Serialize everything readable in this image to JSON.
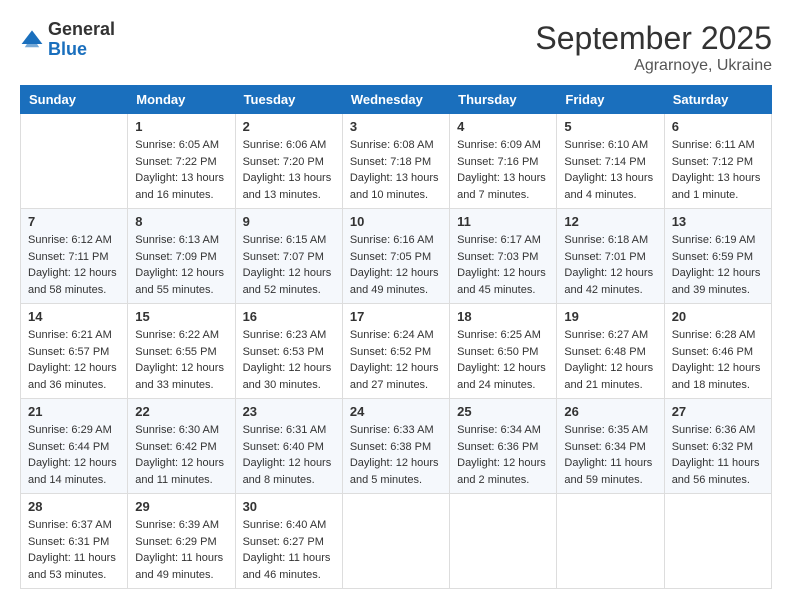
{
  "logo": {
    "general": "General",
    "blue": "Blue"
  },
  "header": {
    "month": "September 2025",
    "location": "Agrarnoye, Ukraine"
  },
  "weekdays": [
    "Sunday",
    "Monday",
    "Tuesday",
    "Wednesday",
    "Thursday",
    "Friday",
    "Saturday"
  ],
  "weeks": [
    [
      {
        "day": "",
        "sunrise": "",
        "sunset": "",
        "daylight": ""
      },
      {
        "day": "1",
        "sunrise": "Sunrise: 6:05 AM",
        "sunset": "Sunset: 7:22 PM",
        "daylight": "Daylight: 13 hours and 16 minutes."
      },
      {
        "day": "2",
        "sunrise": "Sunrise: 6:06 AM",
        "sunset": "Sunset: 7:20 PM",
        "daylight": "Daylight: 13 hours and 13 minutes."
      },
      {
        "day": "3",
        "sunrise": "Sunrise: 6:08 AM",
        "sunset": "Sunset: 7:18 PM",
        "daylight": "Daylight: 13 hours and 10 minutes."
      },
      {
        "day": "4",
        "sunrise": "Sunrise: 6:09 AM",
        "sunset": "Sunset: 7:16 PM",
        "daylight": "Daylight: 13 hours and 7 minutes."
      },
      {
        "day": "5",
        "sunrise": "Sunrise: 6:10 AM",
        "sunset": "Sunset: 7:14 PM",
        "daylight": "Daylight: 13 hours and 4 minutes."
      },
      {
        "day": "6",
        "sunrise": "Sunrise: 6:11 AM",
        "sunset": "Sunset: 7:12 PM",
        "daylight": "Daylight: 13 hours and 1 minute."
      }
    ],
    [
      {
        "day": "7",
        "sunrise": "Sunrise: 6:12 AM",
        "sunset": "Sunset: 7:11 PM",
        "daylight": "Daylight: 12 hours and 58 minutes."
      },
      {
        "day": "8",
        "sunrise": "Sunrise: 6:13 AM",
        "sunset": "Sunset: 7:09 PM",
        "daylight": "Daylight: 12 hours and 55 minutes."
      },
      {
        "day": "9",
        "sunrise": "Sunrise: 6:15 AM",
        "sunset": "Sunset: 7:07 PM",
        "daylight": "Daylight: 12 hours and 52 minutes."
      },
      {
        "day": "10",
        "sunrise": "Sunrise: 6:16 AM",
        "sunset": "Sunset: 7:05 PM",
        "daylight": "Daylight: 12 hours and 49 minutes."
      },
      {
        "day": "11",
        "sunrise": "Sunrise: 6:17 AM",
        "sunset": "Sunset: 7:03 PM",
        "daylight": "Daylight: 12 hours and 45 minutes."
      },
      {
        "day": "12",
        "sunrise": "Sunrise: 6:18 AM",
        "sunset": "Sunset: 7:01 PM",
        "daylight": "Daylight: 12 hours and 42 minutes."
      },
      {
        "day": "13",
        "sunrise": "Sunrise: 6:19 AM",
        "sunset": "Sunset: 6:59 PM",
        "daylight": "Daylight: 12 hours and 39 minutes."
      }
    ],
    [
      {
        "day": "14",
        "sunrise": "Sunrise: 6:21 AM",
        "sunset": "Sunset: 6:57 PM",
        "daylight": "Daylight: 12 hours and 36 minutes."
      },
      {
        "day": "15",
        "sunrise": "Sunrise: 6:22 AM",
        "sunset": "Sunset: 6:55 PM",
        "daylight": "Daylight: 12 hours and 33 minutes."
      },
      {
        "day": "16",
        "sunrise": "Sunrise: 6:23 AM",
        "sunset": "Sunset: 6:53 PM",
        "daylight": "Daylight: 12 hours and 30 minutes."
      },
      {
        "day": "17",
        "sunrise": "Sunrise: 6:24 AM",
        "sunset": "Sunset: 6:52 PM",
        "daylight": "Daylight: 12 hours and 27 minutes."
      },
      {
        "day": "18",
        "sunrise": "Sunrise: 6:25 AM",
        "sunset": "Sunset: 6:50 PM",
        "daylight": "Daylight: 12 hours and 24 minutes."
      },
      {
        "day": "19",
        "sunrise": "Sunrise: 6:27 AM",
        "sunset": "Sunset: 6:48 PM",
        "daylight": "Daylight: 12 hours and 21 minutes."
      },
      {
        "day": "20",
        "sunrise": "Sunrise: 6:28 AM",
        "sunset": "Sunset: 6:46 PM",
        "daylight": "Daylight: 12 hours and 18 minutes."
      }
    ],
    [
      {
        "day": "21",
        "sunrise": "Sunrise: 6:29 AM",
        "sunset": "Sunset: 6:44 PM",
        "daylight": "Daylight: 12 hours and 14 minutes."
      },
      {
        "day": "22",
        "sunrise": "Sunrise: 6:30 AM",
        "sunset": "Sunset: 6:42 PM",
        "daylight": "Daylight: 12 hours and 11 minutes."
      },
      {
        "day": "23",
        "sunrise": "Sunrise: 6:31 AM",
        "sunset": "Sunset: 6:40 PM",
        "daylight": "Daylight: 12 hours and 8 minutes."
      },
      {
        "day": "24",
        "sunrise": "Sunrise: 6:33 AM",
        "sunset": "Sunset: 6:38 PM",
        "daylight": "Daylight: 12 hours and 5 minutes."
      },
      {
        "day": "25",
        "sunrise": "Sunrise: 6:34 AM",
        "sunset": "Sunset: 6:36 PM",
        "daylight": "Daylight: 12 hours and 2 minutes."
      },
      {
        "day": "26",
        "sunrise": "Sunrise: 6:35 AM",
        "sunset": "Sunset: 6:34 PM",
        "daylight": "Daylight: 11 hours and 59 minutes."
      },
      {
        "day": "27",
        "sunrise": "Sunrise: 6:36 AM",
        "sunset": "Sunset: 6:32 PM",
        "daylight": "Daylight: 11 hours and 56 minutes."
      }
    ],
    [
      {
        "day": "28",
        "sunrise": "Sunrise: 6:37 AM",
        "sunset": "Sunset: 6:31 PM",
        "daylight": "Daylight: 11 hours and 53 minutes."
      },
      {
        "day": "29",
        "sunrise": "Sunrise: 6:39 AM",
        "sunset": "Sunset: 6:29 PM",
        "daylight": "Daylight: 11 hours and 49 minutes."
      },
      {
        "day": "30",
        "sunrise": "Sunrise: 6:40 AM",
        "sunset": "Sunset: 6:27 PM",
        "daylight": "Daylight: 11 hours and 46 minutes."
      },
      {
        "day": "",
        "sunrise": "",
        "sunset": "",
        "daylight": ""
      },
      {
        "day": "",
        "sunrise": "",
        "sunset": "",
        "daylight": ""
      },
      {
        "day": "",
        "sunrise": "",
        "sunset": "",
        "daylight": ""
      },
      {
        "day": "",
        "sunrise": "",
        "sunset": "",
        "daylight": ""
      }
    ]
  ]
}
